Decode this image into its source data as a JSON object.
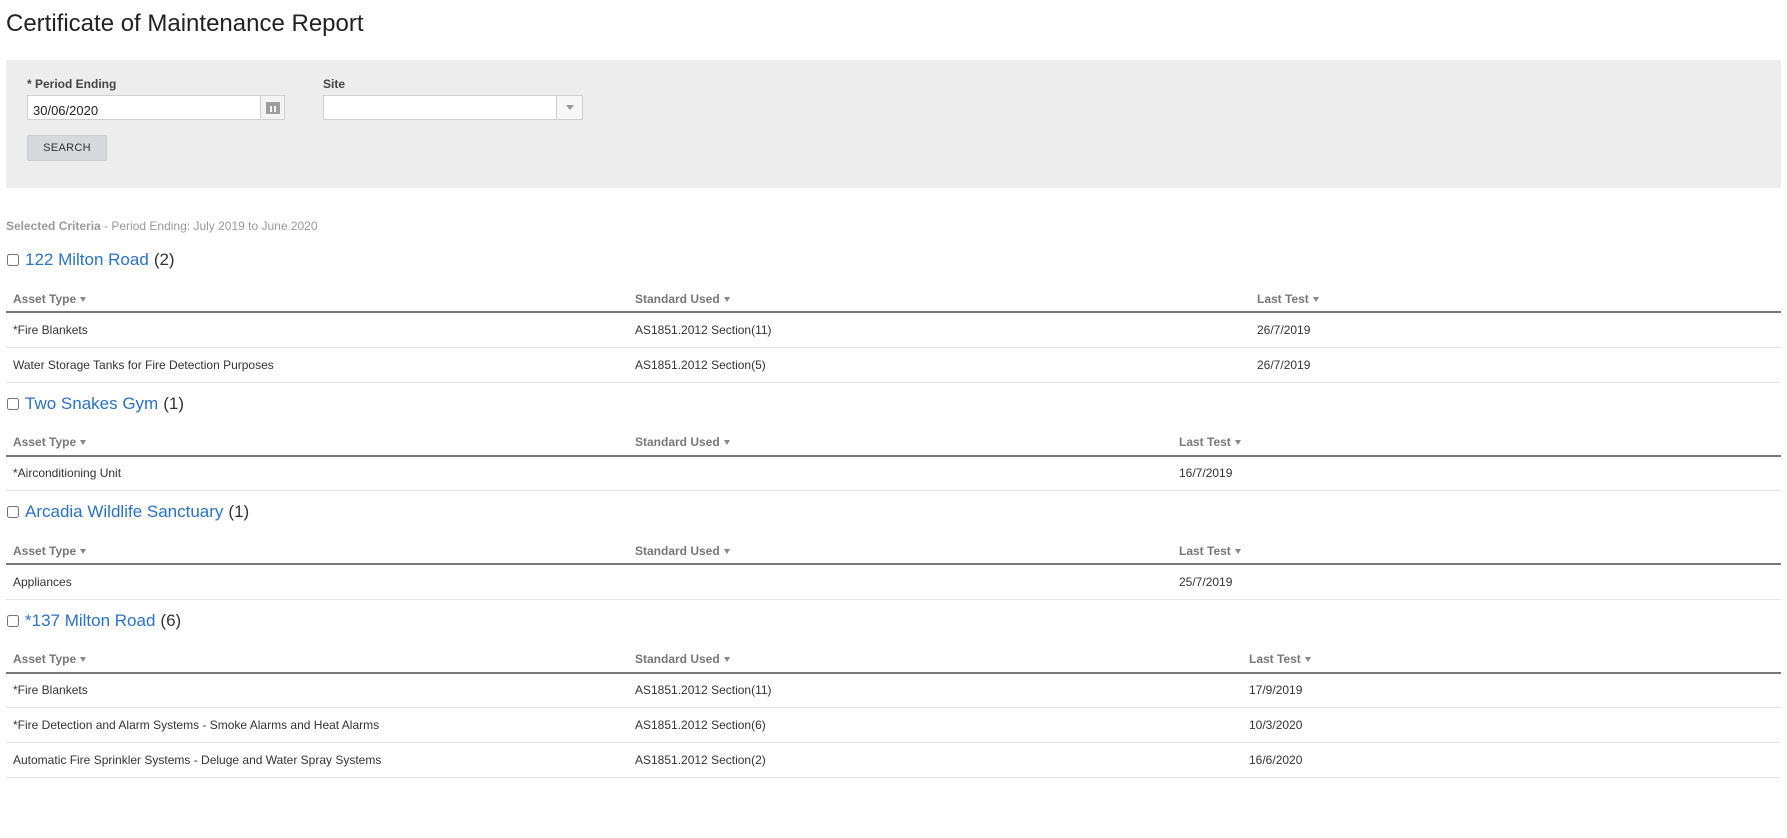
{
  "page_title": "Certificate of Maintenance Report",
  "filters": {
    "period_label": "* Period Ending",
    "period_value": "30/06/2020",
    "site_label": "Site",
    "site_value": "",
    "search_label": "SEARCH"
  },
  "criteria": {
    "label": "Selected Criteria",
    "text": " - Period Ending: July 2019 to June 2020"
  },
  "columns": {
    "asset_type": "Asset Type",
    "standard_used": "Standard Used",
    "last_test": "Last Test"
  },
  "sites": [
    {
      "name": "122 Milton Road",
      "count": "(2)",
      "rows": [
        {
          "asset": "*Fire Blankets",
          "standard": "AS1851.2012 Section(11)",
          "last_test": "26/7/2019"
        },
        {
          "asset": "Water Storage Tanks for Fire Detection Purposes",
          "standard": "AS1851.2012 Section(5)",
          "last_test": "26/7/2019"
        }
      ]
    },
    {
      "name": "Two Snakes Gym",
      "count": "(1)",
      "rows": [
        {
          "asset": "*Airconditioning Unit",
          "standard": "",
          "last_test": "16/7/2019"
        }
      ]
    },
    {
      "name": "Arcadia Wildlife Sanctuary",
      "count": "(1)",
      "rows": [
        {
          "asset": "Appliances",
          "standard": "",
          "last_test": "25/7/2019"
        }
      ]
    },
    {
      "name": "*137 Milton Road",
      "count": "(6)",
      "rows": [
        {
          "asset": "*Fire Blankets",
          "standard": "AS1851.2012 Section(11)",
          "last_test": "17/9/2019"
        },
        {
          "asset": "*Fire Detection and Alarm Systems - Smoke Alarms and Heat Alarms",
          "standard": "AS1851.2012 Section(6)",
          "last_test": "10/3/2020"
        },
        {
          "asset": "Automatic Fire Sprinkler Systems - Deluge and Water Spray Systems",
          "standard": "AS1851.2012 Section(2)",
          "last_test": "16/6/2020"
        }
      ]
    }
  ]
}
